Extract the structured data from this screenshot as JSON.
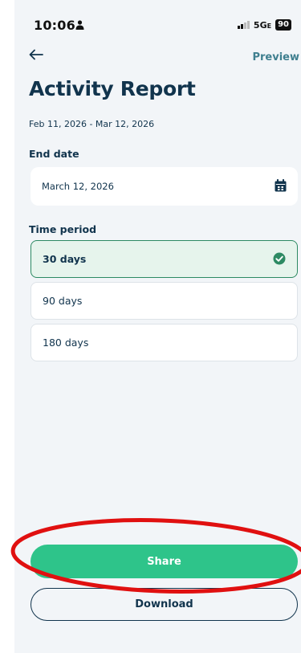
{
  "status_bar": {
    "time": "10:06",
    "network": "5G",
    "network_suffix": "E",
    "battery": "90"
  },
  "header": {
    "back_icon": "arrow-left-icon",
    "preview_label": "Preview"
  },
  "page": {
    "title": "Activity Report",
    "date_range": "Feb 11, 2026 - Mar 12, 2026"
  },
  "end_date": {
    "label": "End date",
    "value": "March 12, 2026",
    "icon": "calendar-icon"
  },
  "time_period": {
    "label": "Time period",
    "options": [
      {
        "label": "30 days",
        "selected": true
      },
      {
        "label": "90 days",
        "selected": false
      },
      {
        "label": "180 days",
        "selected": false
      }
    ]
  },
  "actions": {
    "share_label": "Share",
    "download_label": "Download"
  },
  "colors": {
    "accent": "#2ec48a",
    "selected_border": "#2d8a63",
    "selected_bg": "#e6f4ec",
    "text_primary": "#11344d",
    "annotation_red": "#e01010"
  }
}
